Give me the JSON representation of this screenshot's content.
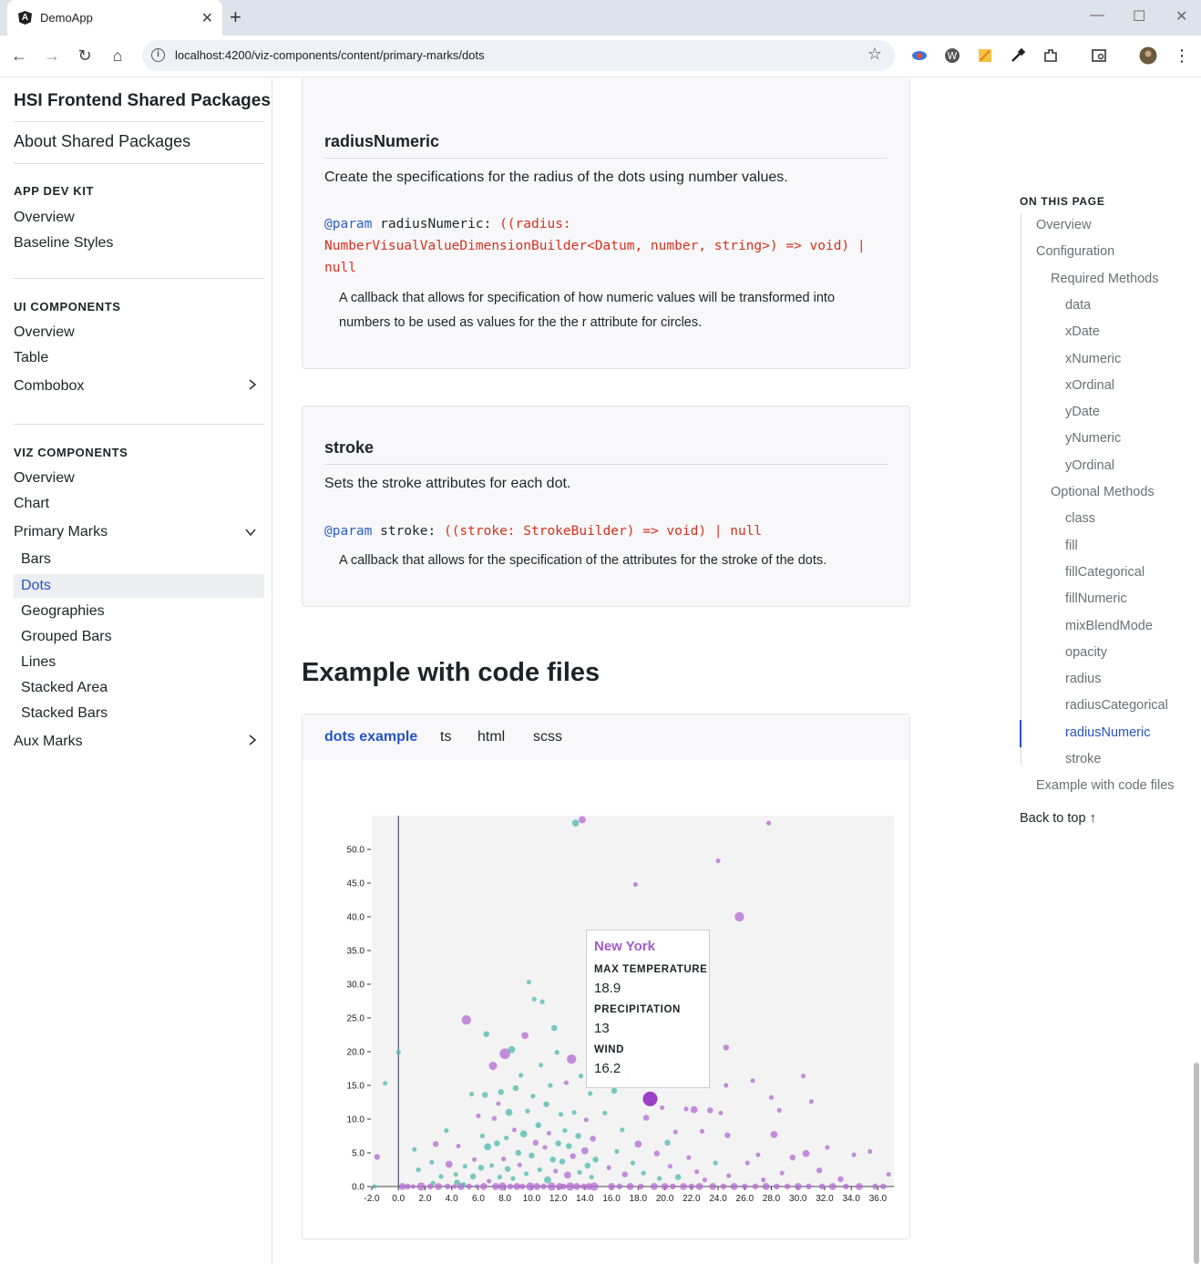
{
  "browser": {
    "tab_title": "DemoApp",
    "url": "localhost:4200/viz-components/content/primary-marks/dots"
  },
  "sidebar": {
    "brand": "HSI Frontend Shared Packages",
    "about": "About Shared Packages",
    "sections": [
      {
        "heading": "APP DEV KIT",
        "items": [
          "Overview",
          "Baseline Styles"
        ]
      },
      {
        "heading": "UI COMPONENTS",
        "items": [
          "Overview",
          "Table",
          "Combobox"
        ]
      },
      {
        "heading": "VIZ COMPONENTS",
        "items": [
          "Overview",
          "Chart",
          "Primary Marks"
        ]
      }
    ],
    "primary_marks": [
      "Bars",
      "Dots",
      "Geographies",
      "Grouped Bars",
      "Lines",
      "Stacked Area",
      "Stacked Bars"
    ],
    "aux_marks": "Aux Marks",
    "active_item": "Dots"
  },
  "methods": {
    "radius_numeric": {
      "title": "radiusNumeric",
      "description": "Create the specifications for the radius of the dots using number values.",
      "param_keyword": "@param",
      "param_name": "radiusNumeric:",
      "param_type_line1": "((radius:",
      "param_type_line2": "NumberVisualValueDimensionBuilder<Datum, number, string>) => void) |",
      "param_type_line3": "null",
      "param_desc": "A callback that allows for specification of how numeric values will be transformed into numbers to be used as values for the the r attribute for circles."
    },
    "stroke": {
      "title": "stroke",
      "description": "Sets the stroke attributes for each dot.",
      "param_keyword": "@param",
      "param_name": "stroke:",
      "param_type": "((stroke: StrokeBuilder) => void) | null",
      "param_desc": "A callback that allows for the specification of the attributes for the stroke of the dots."
    }
  },
  "example": {
    "heading": "Example with code files",
    "tabs": [
      "dots example",
      "ts",
      "html",
      "scss"
    ],
    "active_tab": "dots example"
  },
  "tooltip": {
    "title": "New York",
    "fields": [
      {
        "label": "MAX TEMPERATURE",
        "value": "18.9"
      },
      {
        "label": "PRECIPITATION",
        "value": "13"
      },
      {
        "label": "WIND",
        "value": "16.2"
      }
    ]
  },
  "chart_data": {
    "type": "scatter",
    "x_ticks": [
      "-2.0",
      "0.0",
      "2.0",
      "4.0",
      "6.0",
      "8.0",
      "10.0",
      "12.0",
      "14.0",
      "16.0",
      "18.0",
      "20.0",
      "22.0",
      "24.0",
      "26.0",
      "28.0",
      "30.0",
      "32.0",
      "34.0",
      "36.0"
    ],
    "y_ticks": [
      "0.0",
      "5.0",
      "10.0",
      "15.0",
      "20.0",
      "25.0",
      "30.0",
      "35.0",
      "40.0",
      "45.0",
      "50.0"
    ],
    "xlim": [
      -2,
      37.2
    ],
    "ylim": [
      0,
      55
    ],
    "colors": {
      "series_a": "#4fb8b0",
      "series_b": "#b36ad1",
      "highlight": "#9b3fc6",
      "plot_bg": "#f3f3f3"
    },
    "highlight_point": {
      "x": 18.9,
      "y": 13,
      "r": 16.2
    },
    "points": [
      [
        -1.8,
        0,
        0.3,
        0
      ],
      [
        -1.6,
        4.4,
        0.5,
        1
      ],
      [
        -1,
        15.3,
        0.3,
        0
      ],
      [
        0,
        19.9,
        0.4,
        0
      ],
      [
        0.3,
        0,
        0.6,
        1
      ],
      [
        0.7,
        0,
        0.5,
        1
      ],
      [
        1.1,
        0,
        0.4,
        1
      ],
      [
        1.2,
        5.5,
        0.35,
        0
      ],
      [
        1.5,
        2.5,
        0.4,
        0
      ],
      [
        1.7,
        0,
        0.7,
        1
      ],
      [
        2.4,
        0,
        0.5,
        1
      ],
      [
        2.5,
        3.6,
        0.4,
        0
      ],
      [
        2.6,
        0.5,
        0.3,
        0
      ],
      [
        2.8,
        6.3,
        0.5,
        1
      ],
      [
        3.0,
        0,
        0.6,
        1
      ],
      [
        3.2,
        1.5,
        0.4,
        0
      ],
      [
        3.6,
        8.3,
        0.4,
        0
      ],
      [
        3.7,
        0,
        0.5,
        1
      ],
      [
        3.8,
        3.3,
        0.6,
        1
      ],
      [
        4.2,
        0,
        0.4,
        1
      ],
      [
        4.3,
        1.8,
        0.4,
        0
      ],
      [
        4.4,
        0.6,
        0.5,
        0
      ],
      [
        4.5,
        6.0,
        0.3,
        1
      ],
      [
        4.7,
        0,
        0.6,
        1
      ],
      [
        4.9,
        0.3,
        0.4,
        0
      ],
      [
        5.0,
        3.0,
        0.3,
        0
      ],
      [
        5.1,
        24.7,
        0.8,
        1
      ],
      [
        5.3,
        0,
        0.5,
        1
      ],
      [
        5.5,
        13.7,
        0.4,
        0
      ],
      [
        5.6,
        1.5,
        0.5,
        0
      ],
      [
        5.7,
        4.0,
        0.35,
        1
      ],
      [
        5.9,
        0,
        0.4,
        1
      ],
      [
        6.0,
        10.5,
        0.4,
        1
      ],
      [
        6.2,
        2.8,
        0.5,
        0
      ],
      [
        6.3,
        7.5,
        0.4,
        0
      ],
      [
        6.4,
        0,
        0.6,
        1
      ],
      [
        6.5,
        13.6,
        0.5,
        0
      ],
      [
        6.6,
        22.6,
        0.5,
        0
      ],
      [
        6.7,
        5.9,
        0.6,
        0
      ],
      [
        6.8,
        0.8,
        0.4,
        1
      ],
      [
        7.0,
        3.1,
        0.3,
        0
      ],
      [
        7.1,
        17.9,
        0.7,
        1
      ],
      [
        7.2,
        10.1,
        0.4,
        1
      ],
      [
        7.3,
        0,
        0.6,
        1
      ],
      [
        7.4,
        6.4,
        0.5,
        0
      ],
      [
        7.5,
        12.3,
        0.3,
        1
      ],
      [
        7.6,
        1.4,
        0.4,
        0
      ],
      [
        7.7,
        14.0,
        0.5,
        0
      ],
      [
        7.8,
        0,
        0.7,
        1
      ],
      [
        7.9,
        4.1,
        0.4,
        1
      ],
      [
        8.0,
        19.7,
        0.9,
        1
      ],
      [
        8.1,
        7.2,
        0.4,
        0
      ],
      [
        8.2,
        2.6,
        0.5,
        0
      ],
      [
        8.3,
        11.0,
        0.6,
        0
      ],
      [
        8.4,
        0,
        0.5,
        1
      ],
      [
        8.5,
        20.3,
        0.6,
        0
      ],
      [
        8.6,
        1.2,
        0.4,
        0
      ],
      [
        8.7,
        8.4,
        0.3,
        1
      ],
      [
        8.8,
        14.6,
        0.5,
        0
      ],
      [
        8.9,
        0,
        0.6,
        1
      ],
      [
        9.0,
        5.0,
        0.5,
        0
      ],
      [
        9.1,
        3.2,
        0.4,
        1
      ],
      [
        9.2,
        16.5,
        0.4,
        0
      ],
      [
        9.3,
        0,
        0.5,
        1
      ],
      [
        9.4,
        7.8,
        0.6,
        0
      ],
      [
        9.5,
        22.4,
        0.6,
        1
      ],
      [
        9.6,
        1.9,
        0.4,
        0
      ],
      [
        9.7,
        11.2,
        0.4,
        0
      ],
      [
        9.8,
        30.3,
        0.35,
        0
      ],
      [
        9.9,
        0,
        0.7,
        1
      ],
      [
        10.0,
        4.6,
        0.5,
        0
      ],
      [
        10.1,
        13.4,
        0.4,
        0
      ],
      [
        10.2,
        27.8,
        0.4,
        0
      ],
      [
        10.3,
        6.5,
        0.5,
        1
      ],
      [
        10.4,
        0,
        0.6,
        1
      ],
      [
        10.5,
        9.1,
        0.5,
        0
      ],
      [
        10.6,
        2.5,
        0.4,
        0
      ],
      [
        10.7,
        18.0,
        0.3,
        0
      ],
      [
        10.8,
        27.4,
        0.4,
        0
      ],
      [
        10.9,
        0,
        0.5,
        1
      ],
      [
        11.0,
        5.8,
        0.4,
        1
      ],
      [
        11.1,
        12.2,
        0.5,
        0
      ],
      [
        11.2,
        1.0,
        0.6,
        0
      ],
      [
        11.3,
        7.9,
        0.3,
        1
      ],
      [
        11.4,
        15.0,
        0.4,
        0
      ],
      [
        11.5,
        0,
        0.7,
        1
      ],
      [
        11.6,
        4.0,
        0.5,
        0
      ],
      [
        11.7,
        23.5,
        0.5,
        0
      ],
      [
        11.8,
        2.3,
        0.4,
        1
      ],
      [
        11.9,
        19.9,
        0.4,
        0
      ],
      [
        12.0,
        6.4,
        0.5,
        0
      ],
      [
        12.1,
        0,
        0.6,
        1
      ],
      [
        12.2,
        10.7,
        0.4,
        0
      ],
      [
        12.3,
        3.7,
        0.5,
        0
      ],
      [
        12.4,
        0,
        0.5,
        1
      ],
      [
        12.5,
        8.3,
        0.4,
        0
      ],
      [
        12.6,
        15.4,
        0.4,
        1
      ],
      [
        12.7,
        1.7,
        0.6,
        1
      ],
      [
        12.8,
        6.0,
        0.5,
        0
      ],
      [
        12.9,
        0,
        0.7,
        1
      ],
      [
        13.0,
        18.9,
        0.8,
        1
      ],
      [
        13.1,
        4.5,
        0.5,
        1
      ],
      [
        13.2,
        11.0,
        0.4,
        0
      ],
      [
        13.3,
        53.9,
        0.6,
        0
      ],
      [
        13.4,
        0,
        0.6,
        1
      ],
      [
        13.5,
        7.5,
        0.5,
        0
      ],
      [
        13.6,
        2.1,
        0.4,
        0
      ],
      [
        13.7,
        16.4,
        0.4,
        0
      ],
      [
        13.8,
        54.4,
        0.6,
        1
      ],
      [
        13.9,
        0,
        0.5,
        1
      ],
      [
        14.0,
        5.3,
        0.6,
        1
      ],
      [
        14.1,
        9.9,
        0.4,
        1
      ],
      [
        14.2,
        3.1,
        0.5,
        0
      ],
      [
        14.3,
        0,
        0.6,
        1
      ],
      [
        14.4,
        13.8,
        0.4,
        0
      ],
      [
        14.5,
        1.4,
        0.4,
        0
      ],
      [
        14.6,
        7.1,
        0.5,
        1
      ],
      [
        14.7,
        0,
        0.7,
        1
      ],
      [
        14.8,
        4.0,
        0.5,
        0
      ],
      [
        15.2,
        20.0,
        0.3,
        0
      ],
      [
        15.5,
        10.9,
        0.4,
        0
      ],
      [
        15.8,
        2.8,
        0.4,
        1
      ],
      [
        16.0,
        0,
        0.6,
        1
      ],
      [
        16.2,
        14.2,
        0.5,
        0
      ],
      [
        16.4,
        5.2,
        0.4,
        0
      ],
      [
        16.6,
        0,
        0.5,
        1
      ],
      [
        16.8,
        8.4,
        0.4,
        0
      ],
      [
        17.0,
        1.8,
        0.5,
        1
      ],
      [
        17.2,
        16.3,
        0.4,
        0
      ],
      [
        17.4,
        0,
        0.6,
        1
      ],
      [
        17.6,
        3.5,
        0.4,
        0
      ],
      [
        17.8,
        44.8,
        0.4,
        1
      ],
      [
        18.0,
        6.3,
        0.6,
        1
      ],
      [
        18.2,
        0,
        0.5,
        1
      ],
      [
        18.4,
        2.0,
        0.4,
        0
      ],
      [
        18.6,
        10.2,
        0.5,
        1
      ],
      [
        18.9,
        13,
        1.1,
        2
      ],
      [
        19.2,
        0,
        0.6,
        1
      ],
      [
        19.4,
        4.9,
        0.5,
        1
      ],
      [
        19.6,
        1.2,
        0.4,
        0
      ],
      [
        19.8,
        11.7,
        0.4,
        1
      ],
      [
        20.0,
        0,
        0.6,
        1
      ],
      [
        20.2,
        6.5,
        0.5,
        0
      ],
      [
        20.4,
        3.0,
        0.4,
        1
      ],
      [
        20.6,
        0,
        0.5,
        1
      ],
      [
        20.8,
        8.1,
        0.4,
        1
      ],
      [
        21.0,
        1.4,
        0.5,
        0
      ],
      [
        21.4,
        0,
        0.6,
        1
      ],
      [
        21.6,
        11.5,
        0.4,
        1
      ],
      [
        21.8,
        4.3,
        0.4,
        1
      ],
      [
        22.0,
        0,
        0.5,
        1
      ],
      [
        22.2,
        11.4,
        0.6,
        1
      ],
      [
        22.4,
        2.2,
        0.4,
        1
      ],
      [
        22.6,
        0,
        0.6,
        1
      ],
      [
        22.8,
        8.2,
        0.4,
        1
      ],
      [
        23.0,
        1.0,
        0.4,
        1
      ],
      [
        23.4,
        11.3,
        0.5,
        1
      ],
      [
        23.6,
        0,
        0.6,
        1
      ],
      [
        23.8,
        3.5,
        0.4,
        0
      ],
      [
        24.0,
        48.3,
        0.4,
        1
      ],
      [
        24.2,
        10.9,
        0.3,
        1
      ],
      [
        24.4,
        0,
        0.5,
        1
      ],
      [
        24.6,
        20.6,
        0.5,
        1
      ],
      [
        24.6,
        15.0,
        0.4,
        1
      ],
      [
        24.7,
        7.6,
        0.5,
        1
      ],
      [
        24.8,
        1.6,
        0.4,
        1
      ],
      [
        25.2,
        0,
        0.6,
        1
      ],
      [
        25.6,
        40.0,
        0.8,
        1
      ],
      [
        26.0,
        0,
        0.5,
        1
      ],
      [
        26.2,
        3.5,
        0.4,
        1
      ],
      [
        26.6,
        15.7,
        0.4,
        1
      ],
      [
        26.8,
        0,
        0.5,
        1
      ],
      [
        27.0,
        4.7,
        0.4,
        1
      ],
      [
        27.4,
        1.0,
        0.4,
        1
      ],
      [
        27.6,
        0,
        0.6,
        1
      ],
      [
        27.8,
        53.9,
        0.4,
        1
      ],
      [
        28.0,
        13.2,
        0.4,
        1
      ],
      [
        28.2,
        7.7,
        0.6,
        1
      ],
      [
        28.4,
        0,
        0.5,
        1
      ],
      [
        28.6,
        11.3,
        0.4,
        1
      ],
      [
        28.8,
        2.0,
        0.4,
        1
      ],
      [
        29.2,
        0,
        0.5,
        1
      ],
      [
        29.6,
        4.3,
        0.5,
        1
      ],
      [
        30.0,
        0,
        0.6,
        1
      ],
      [
        30.4,
        16.4,
        0.4,
        1
      ],
      [
        30.6,
        4.9,
        0.6,
        1
      ],
      [
        30.8,
        0,
        0.5,
        1
      ],
      [
        31.0,
        12.6,
        0.4,
        1
      ],
      [
        31.6,
        2.4,
        0.5,
        1
      ],
      [
        31.8,
        0,
        0.5,
        1
      ],
      [
        32.2,
        5.8,
        0.4,
        1
      ],
      [
        32.6,
        0,
        0.6,
        1
      ],
      [
        33.2,
        1.1,
        0.5,
        1
      ],
      [
        33.6,
        0,
        0.5,
        1
      ],
      [
        34.2,
        4.7,
        0.4,
        1
      ],
      [
        34.6,
        0,
        0.6,
        1
      ],
      [
        35.4,
        5.2,
        0.4,
        1
      ],
      [
        35.8,
        0,
        0.5,
        1
      ],
      [
        36.8,
        1.8,
        0.4,
        1
      ],
      [
        36.4,
        0,
        0.5,
        1
      ]
    ]
  },
  "toc": {
    "heading": "ON THIS PAGE",
    "items": [
      {
        "label": "Overview",
        "level": 1
      },
      {
        "label": "Configuration",
        "level": 1
      },
      {
        "label": "Required Methods",
        "level": 2
      },
      {
        "label": "data",
        "level": 3
      },
      {
        "label": "xDate",
        "level": 3
      },
      {
        "label": "xNumeric",
        "level": 3
      },
      {
        "label": "xOrdinal",
        "level": 3
      },
      {
        "label": "yDate",
        "level": 3
      },
      {
        "label": "yNumeric",
        "level": 3
      },
      {
        "label": "yOrdinal",
        "level": 3
      },
      {
        "label": "Optional Methods",
        "level": 2
      },
      {
        "label": "class",
        "level": 3
      },
      {
        "label": "fill",
        "level": 3
      },
      {
        "label": "fillCategorical",
        "level": 3
      },
      {
        "label": "fillNumeric",
        "level": 3
      },
      {
        "label": "mixBlendMode",
        "level": 3
      },
      {
        "label": "opacity",
        "level": 3
      },
      {
        "label": "radius",
        "level": 3
      },
      {
        "label": "radiusCategorical",
        "level": 3
      },
      {
        "label": "radiusNumeric",
        "level": 3
      },
      {
        "label": "stroke",
        "level": 3
      },
      {
        "label": "Example with code files",
        "level": 1
      }
    ],
    "active": "radiusNumeric",
    "back_to_top": "Back to top ↑"
  }
}
